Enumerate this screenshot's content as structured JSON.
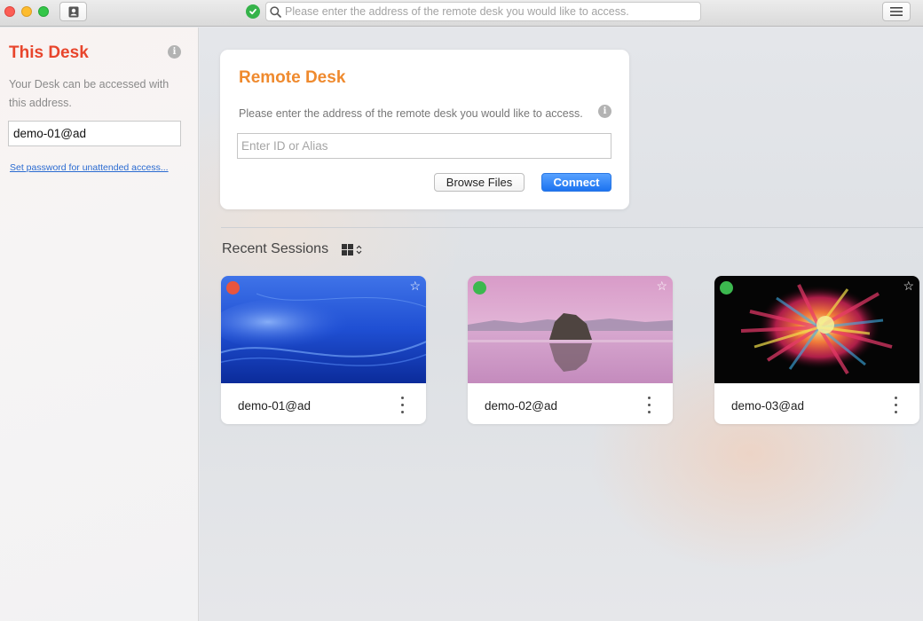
{
  "colors": {
    "this_desk_title": "#e8452c",
    "remote_desk_title": "#ef8a2e",
    "connect_button": "#1c73f0",
    "status_online": "#35b34a",
    "status_offline": "#e8553e",
    "link": "#2a6bd1"
  },
  "toolbar": {
    "contacts_icon": "address-book-icon",
    "status_icon": "check-circle-icon",
    "address_placeholder": "Please enter the address of the remote desk you would like to access.",
    "menu_icon": "hamburger-menu-icon"
  },
  "sidebar": {
    "title": "This Desk",
    "description": "Your Desk can be accessed with this address.",
    "address_value": "demo-01@ad",
    "set_password_link": "Set password for unattended access..."
  },
  "remote_desk": {
    "title": "Remote Desk",
    "description": "Please enter the address of the remote desk you would like to access.",
    "input_placeholder": "Enter ID or Alias",
    "browse_label": "Browse Files",
    "connect_label": "Connect"
  },
  "recent_sessions": {
    "title": "Recent Sessions",
    "sessions": [
      {
        "name": "demo-01@ad",
        "status": "offline",
        "thumbnail": "blue-wave-wallpaper"
      },
      {
        "name": "demo-02@ad",
        "status": "online",
        "thumbnail": "pink-lake-rock-wallpaper"
      },
      {
        "name": "demo-03@ad",
        "status": "online",
        "thumbnail": "color-powder-explosion-wallpaper"
      }
    ]
  }
}
